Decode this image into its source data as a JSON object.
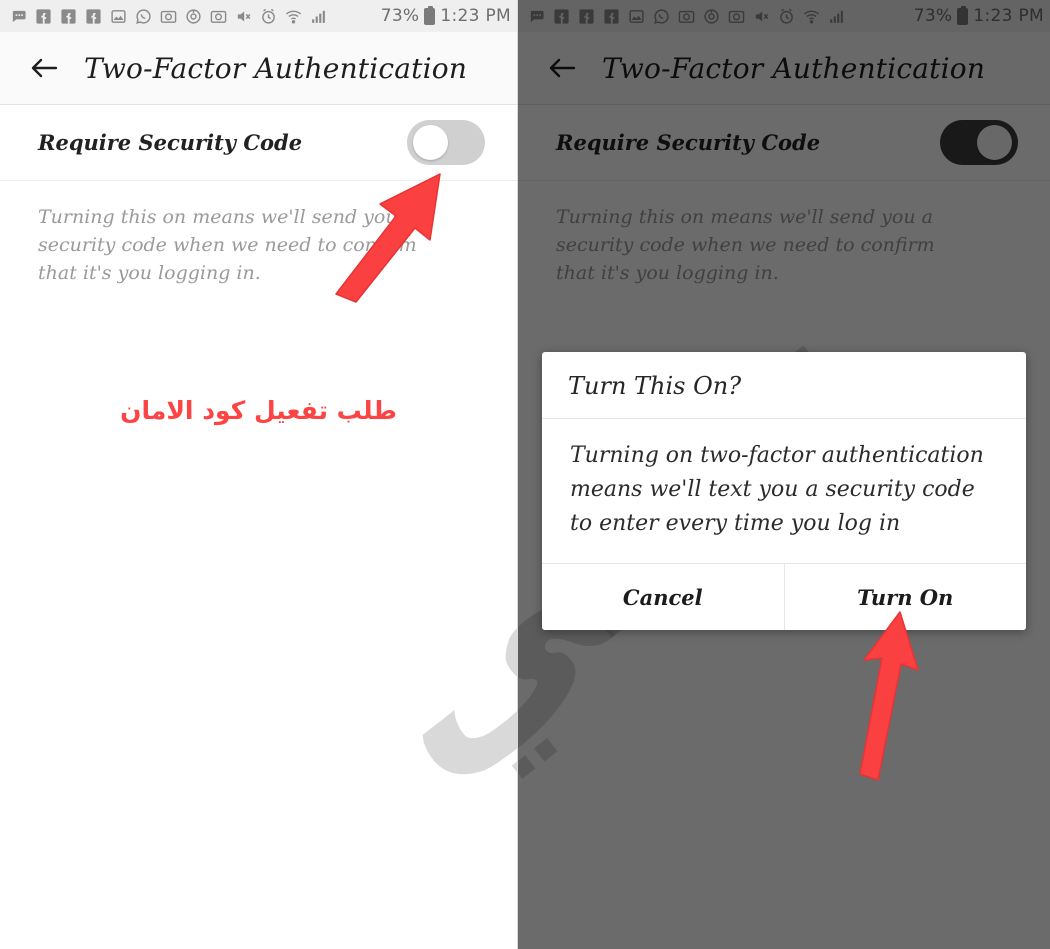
{
  "statusbar": {
    "icons": [
      "message-bubble-icon",
      "facebook-icon",
      "facebook-icon",
      "facebook-icon",
      "photo-icon",
      "whatsapp-icon",
      "camera-icon",
      "target-circle-icon",
      "camera-icon",
      "mute-icon",
      "alarm-icon",
      "wifi-icon",
      "signal-icon"
    ],
    "battery_percent": "73%",
    "battery_icon": "battery-full-icon",
    "time": "1:23 PM"
  },
  "appbar": {
    "back_icon": "back-arrow-icon",
    "title": "Two-Factor Authentication"
  },
  "settings": {
    "row_label": "Require Security Code",
    "toggle_off_state": "off",
    "toggle_on_state": "on",
    "description": "Turning this on means we'll send you a security code when we need to confirm that it's you logging in."
  },
  "annotations": {
    "arabic_caption": "طلب تفعيل  كود الامان",
    "arrow_to_toggle": "red-up-right-arrow",
    "arrow_to_turn_on": "red-up-arrow",
    "accent_red": "#fc4444"
  },
  "watermark": {
    "text": "تقني"
  },
  "dialog": {
    "title": "Turn This On?",
    "message": "Turning on two-factor authentication means we'll text you a security code to enter every time you log in",
    "cancel_label": "Cancel",
    "confirm_label": "Turn On"
  },
  "colors": {
    "toggle_off": "#d0d0d0",
    "toggle_on": "#3c3c3c",
    "statusbar_bg": "#efefef",
    "appbar_bg": "#fafafa",
    "dim_overlay": "rgba(0,0,0,0.58)"
  }
}
